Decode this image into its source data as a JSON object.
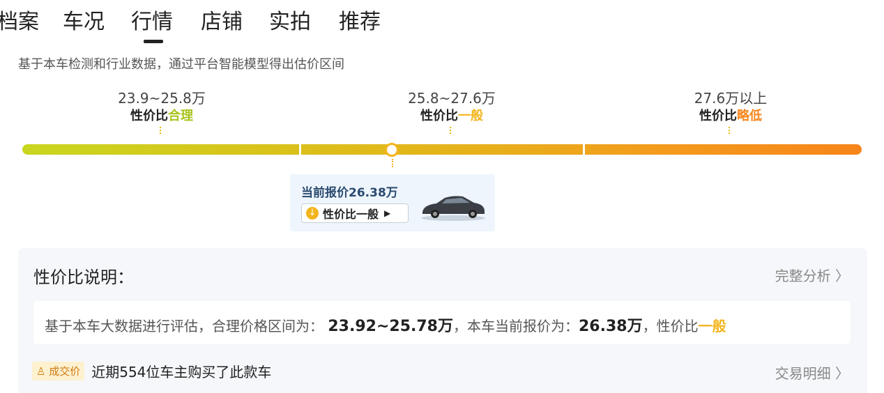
{
  "tabs": [
    {
      "label": "档案"
    },
    {
      "label": "车况"
    },
    {
      "label": "行情"
    },
    {
      "label": "店铺"
    },
    {
      "label": "实拍"
    },
    {
      "label": "推荐"
    }
  ],
  "active_tab": "行情",
  "subtitle": "基于本车检测和行业数据，通过平台智能模型得出估价区间",
  "ranges": [
    {
      "price": "23.9~25.8万",
      "verdict_prefix": "性价比",
      "verdict": "合理",
      "color": "#a8c41c"
    },
    {
      "price": "25.8~27.6万",
      "verdict_prefix": "性价比",
      "verdict": "一般",
      "color": "#f3b51d"
    },
    {
      "price": "27.6万以上",
      "verdict_prefix": "性价比",
      "verdict": "略低",
      "color": "#f7851a"
    }
  ],
  "current_price": {
    "label": "当前报价26.38万",
    "badge": "性价比一般",
    "position_fraction": 0.44
  },
  "explanation": {
    "title": "性价比说明：",
    "full_analysis_link": "完整分析 〉",
    "line_prefix": "基于本车大数据进行评估，合理价格区间为：",
    "reasonable_range": "23.92~25.78万",
    "line_middle": "，本车当前报价为：",
    "current_price": "26.38万",
    "line_suffix": "，性价比",
    "verdict": "一般"
  },
  "deal": {
    "tag": "成交价",
    "note": "近期554位车主购买了此款车",
    "detail_link": "交易明细 〉"
  },
  "colors": {
    "accent": "#f3b51d",
    "card_bg": "#eef5fc",
    "panel_bg": "#f5f7fa"
  }
}
